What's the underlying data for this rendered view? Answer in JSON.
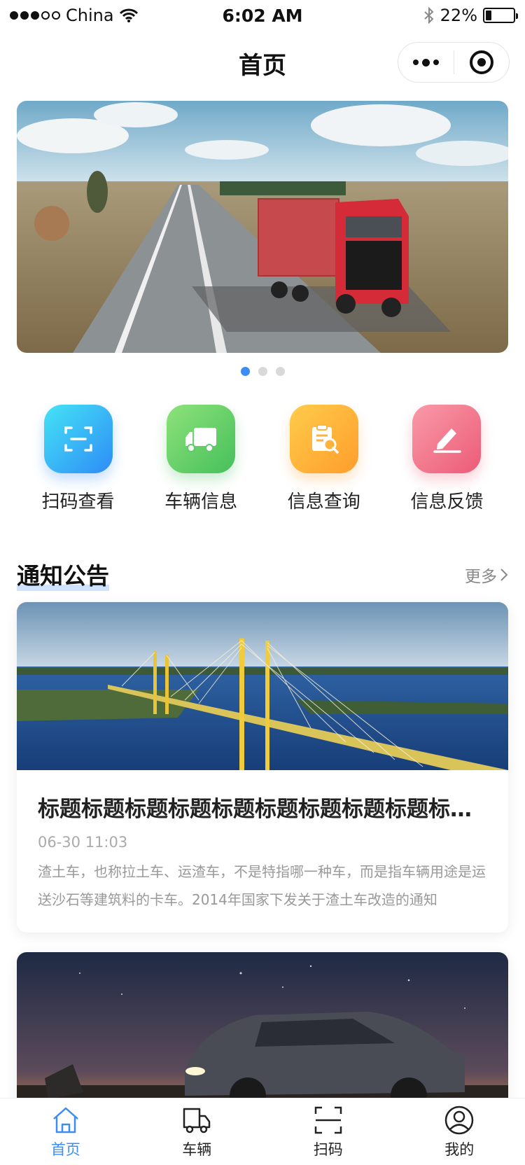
{
  "status_bar": {
    "carrier": "China",
    "time": "6:02 AM",
    "battery": "22%",
    "battery_level": 0.22
  },
  "nav": {
    "title": "首页"
  },
  "banner": {
    "active_index": 0,
    "count": 3
  },
  "quick_menu": [
    {
      "label": "扫码查看",
      "icon": "scan-icon",
      "color": "#2e8cf7"
    },
    {
      "label": "车辆信息",
      "icon": "truck-icon",
      "color": "#46c05b"
    },
    {
      "label": "信息查询",
      "icon": "clipboard-search-icon",
      "color": "#ff9d2b"
    },
    {
      "label": "信息反馈",
      "icon": "edit-icon",
      "color": "#ec5b77"
    }
  ],
  "notices": {
    "title": "通知公告",
    "more": "更多",
    "items": [
      {
        "title": "标题标题标题标题标题标题标题标题标题标题标题标题",
        "time": "06-30 11:03",
        "desc": "渣土车，也称拉土车、运渣车，不是特指哪一种车，而是指车辆用途是运送沙石等建筑料的卡车。2014年国家下发关于渣土车改造的通知"
      }
    ]
  },
  "tab_bar": [
    {
      "label": "首页",
      "icon": "home-icon",
      "active": true
    },
    {
      "label": "车辆",
      "icon": "truck-icon",
      "active": false
    },
    {
      "label": "扫码",
      "icon": "scan-icon",
      "active": false
    },
    {
      "label": "我的",
      "icon": "user-icon",
      "active": false
    }
  ],
  "colors": {
    "accent": "#3b8cf5"
  }
}
